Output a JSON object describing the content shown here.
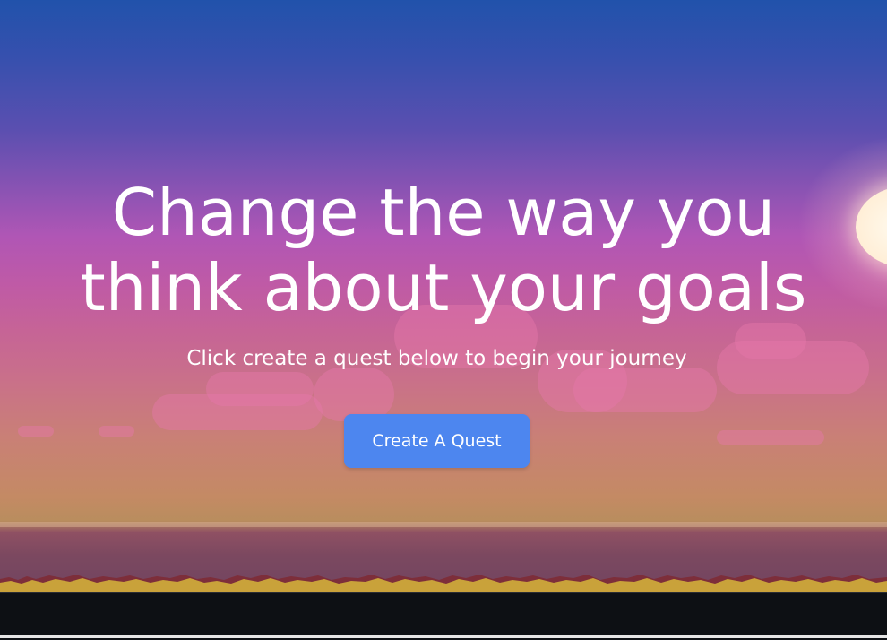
{
  "hero": {
    "title_line1": "Change the way you",
    "title_line2": "think about your goals",
    "subtitle": "Click create a quest below to begin your journey",
    "cta_label": "Create A Quest"
  },
  "colors": {
    "sky_top": "#2152ab",
    "sky_mid": "#b056b5",
    "sky_low": "#c98076",
    "button": "#4d86ef",
    "text": "#ffffff",
    "footer": "#0d1014"
  }
}
